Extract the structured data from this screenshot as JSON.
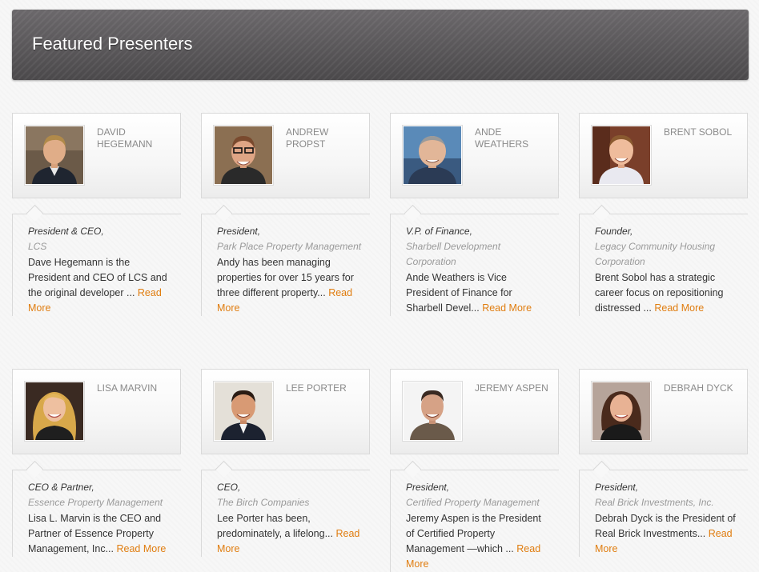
{
  "header": {
    "title": "Featured Presenters"
  },
  "presenters": [
    {
      "name": "DAVID HEGEMANN",
      "role": "President & CEO,",
      "company": "LCS",
      "bio": "Dave Hegemann is the President and CEO of LCS and the original developer ... ",
      "read_more": "Read More"
    },
    {
      "name": "ANDREW PROPST",
      "role": "President,",
      "company": "Park Place Property Management",
      "bio": "Andy has been managing properties for over 15 years for three different property... ",
      "read_more": "Read More"
    },
    {
      "name": "ANDE WEATHERS",
      "role": "V.P. of Finance,",
      "company": "Sharbell Development Corporation",
      "bio": "Ande Weathers is Vice President of Finance for Sharbell Devel... ",
      "read_more": "Read More"
    },
    {
      "name": "BRENT SOBOL",
      "role": "Founder,",
      "company": "Legacy Community Housing Corporation",
      "bio": "Brent Sobol has a strategic career focus on repositioning distressed ... ",
      "read_more": "Read More"
    },
    {
      "name": "LISA MARVIN",
      "role": "CEO & Partner,",
      "company": "Essence Property Management",
      "bio": "Lisa L. Marvin is the CEO and Partner of Essence Property Management, Inc... ",
      "read_more": "Read More"
    },
    {
      "name": "LEE PORTER",
      "role": "CEO,",
      "company": "The Birch Companies",
      "bio": "Lee Porter has been, predominately, a lifelong... ",
      "read_more": "Read More"
    },
    {
      "name": "JEREMY ASPEN",
      "role": "President,",
      "company": "Certified Property Management",
      "bio": "Jeremy Aspen is the President of Certified Property Management —which ... ",
      "read_more": "Read More"
    },
    {
      "name": "DEBRAH DYCK",
      "role": "President,",
      "company": "Real Brick Investments, Inc.",
      "bio": "Debrah Dyck is the President of Real Brick Investments... ",
      "read_more": "Read More"
    }
  ],
  "colors": {
    "header_bg": "#4f4d4f",
    "link": "#e07d10",
    "name_text": "#8a8a8a"
  }
}
